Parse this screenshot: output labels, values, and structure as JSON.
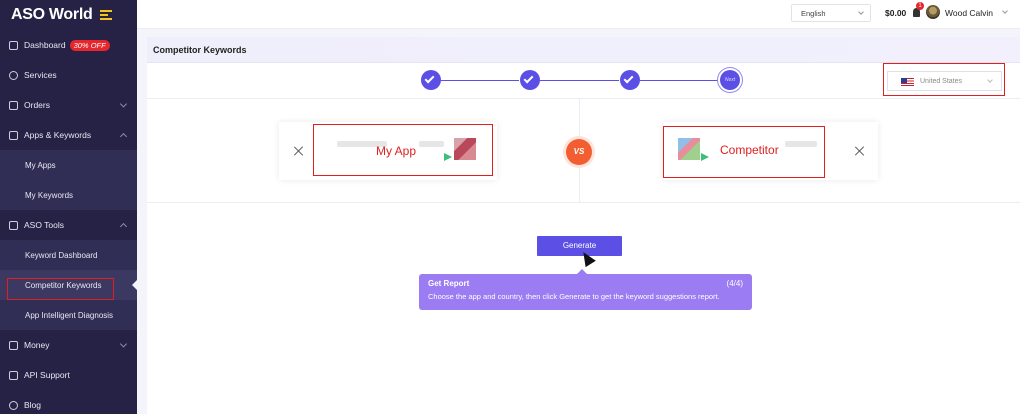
{
  "brand": {
    "name": "ASO World"
  },
  "sidebar": {
    "items": [
      {
        "label": "Dashboard",
        "badge": "30% OFF",
        "icon": "dashboard-icon"
      },
      {
        "label": "Services",
        "icon": "services-icon"
      },
      {
        "label": "Orders",
        "icon": "orders-icon"
      },
      {
        "label": "Apps & Keywords",
        "icon": "apps-keywords-icon",
        "children": [
          "My Apps",
          "My Keywords"
        ]
      },
      {
        "label": "ASO Tools",
        "icon": "aso-tools-icon",
        "children": [
          "Keyword Dashboard",
          "Competitor Keywords",
          "App Intelligent Diagnosis"
        ]
      },
      {
        "label": "Money",
        "icon": "money-icon"
      },
      {
        "label": "API Support",
        "icon": "api-icon"
      },
      {
        "label": "Blog",
        "icon": "blog-icon"
      }
    ],
    "active": "Competitor Keywords"
  },
  "header": {
    "language": "English",
    "balance": "$0.00",
    "notification_count": "1",
    "user_name": "Wood Calvin"
  },
  "page": {
    "title": "Competitor Keywords",
    "steps": {
      "total": 4,
      "completed": 3,
      "current_label": "Next"
    },
    "country": "United States",
    "my_app_label": "My App",
    "competitor_label": "Competitor",
    "vs_label": "VS",
    "generate_label": "Generate"
  },
  "tooltip": {
    "title": "Get Report",
    "counter": "(4/4)",
    "body": "Choose the app and country, then click Generate to get the keyword suggestions report."
  },
  "colors": {
    "accent": "#5b4fe6",
    "sidebar": "#252246",
    "highlight": "#e02020",
    "vs": "#f25d32",
    "tooltip": "#9b7cf2"
  }
}
